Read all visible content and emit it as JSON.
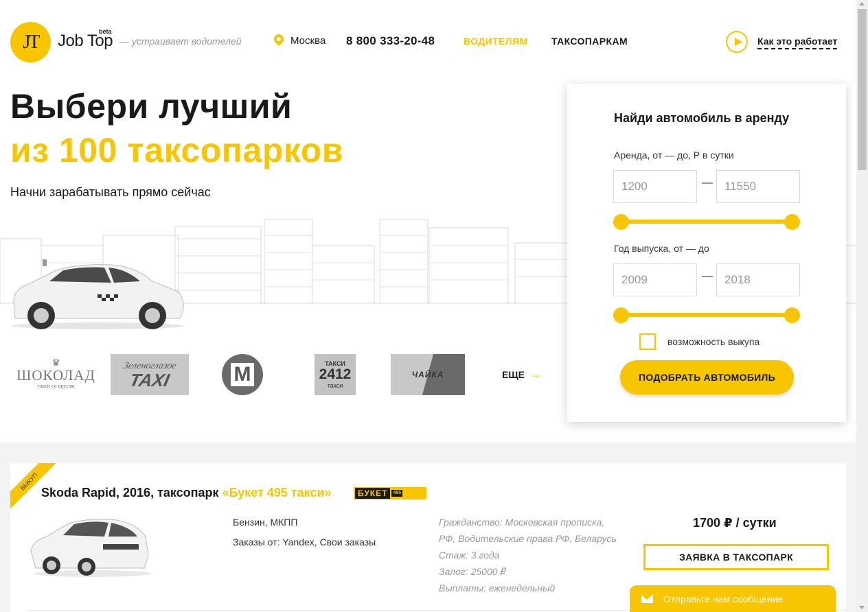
{
  "header": {
    "logo_mark": "JT",
    "logo_name": "Job Top",
    "logo_badge": "beta",
    "tagline": "— устраивает водителей",
    "city": "Москва",
    "phone": "8 800 333-20-48",
    "nav": {
      "drivers": "ВОДИТЕЛЯМ",
      "parks": "ТАКСОПАРКАМ"
    },
    "how_it_works": "Как это работает"
  },
  "hero": {
    "title_line1": "Выбери лучший",
    "title_line2": "из 100 таксопарков",
    "subtitle": "Начни зарабатывать прямо сейчас"
  },
  "partners": {
    "shokolad": {
      "crown": "♛",
      "name": "ШОКОЛАД",
      "slogan": "такси со вкусом"
    },
    "zelenoglazoe": {
      "top": "Зеленоглазое",
      "bottom": "TAXI"
    },
    "m_taxi": {
      "letter": "M"
    },
    "taxi_2412": {
      "top": "ТАКСИ",
      "number": "2412",
      "bottom": "такси"
    },
    "chaika": {
      "name": "ЧАЙКА"
    },
    "more_label": "ЕЩЕ",
    "more_arrow": "→"
  },
  "search": {
    "title": "Найди автомобиль в аренду",
    "price_label": "Аренда, от — до, Р в сутки",
    "price_from": "1200",
    "price_to": "11550",
    "year_label": "Год выпуска, от — до",
    "year_from": "2009",
    "year_to": "2018",
    "dash": "—",
    "buyout_label": "возможность выкупа",
    "buyout_checked": false,
    "submit": "ПОДОБРАТЬ АВТОМОБИЛЬ"
  },
  "listing": {
    "ribbon": "ВЫКУП",
    "title_prefix": "Skoda Rapid, 2016, таксопарк ",
    "park_name": "«Букет 495 такси»",
    "park_logo_main": "БУКЕТ",
    "park_logo_sub": "495",
    "fuel": "Бензин, МКПП",
    "orders": "Заказы от: Yandex, Свои заказы",
    "conditions": [
      "Гражданство: Московская прописка,",
      "РФ, Водительские права РФ, Беларусь",
      "Стаж: 3 года",
      "Залог: 25000 ₽",
      "Выплаты: еженедельный"
    ],
    "price": "1700 ₽ / сутки",
    "apply": "ЗАЯВКА В ТАКСОПАРК"
  },
  "chat": {
    "label": "Отправьте нам сообщение"
  },
  "colors": {
    "accent": "#f7c600",
    "text": "#1a1a1a",
    "muted": "#999999"
  }
}
